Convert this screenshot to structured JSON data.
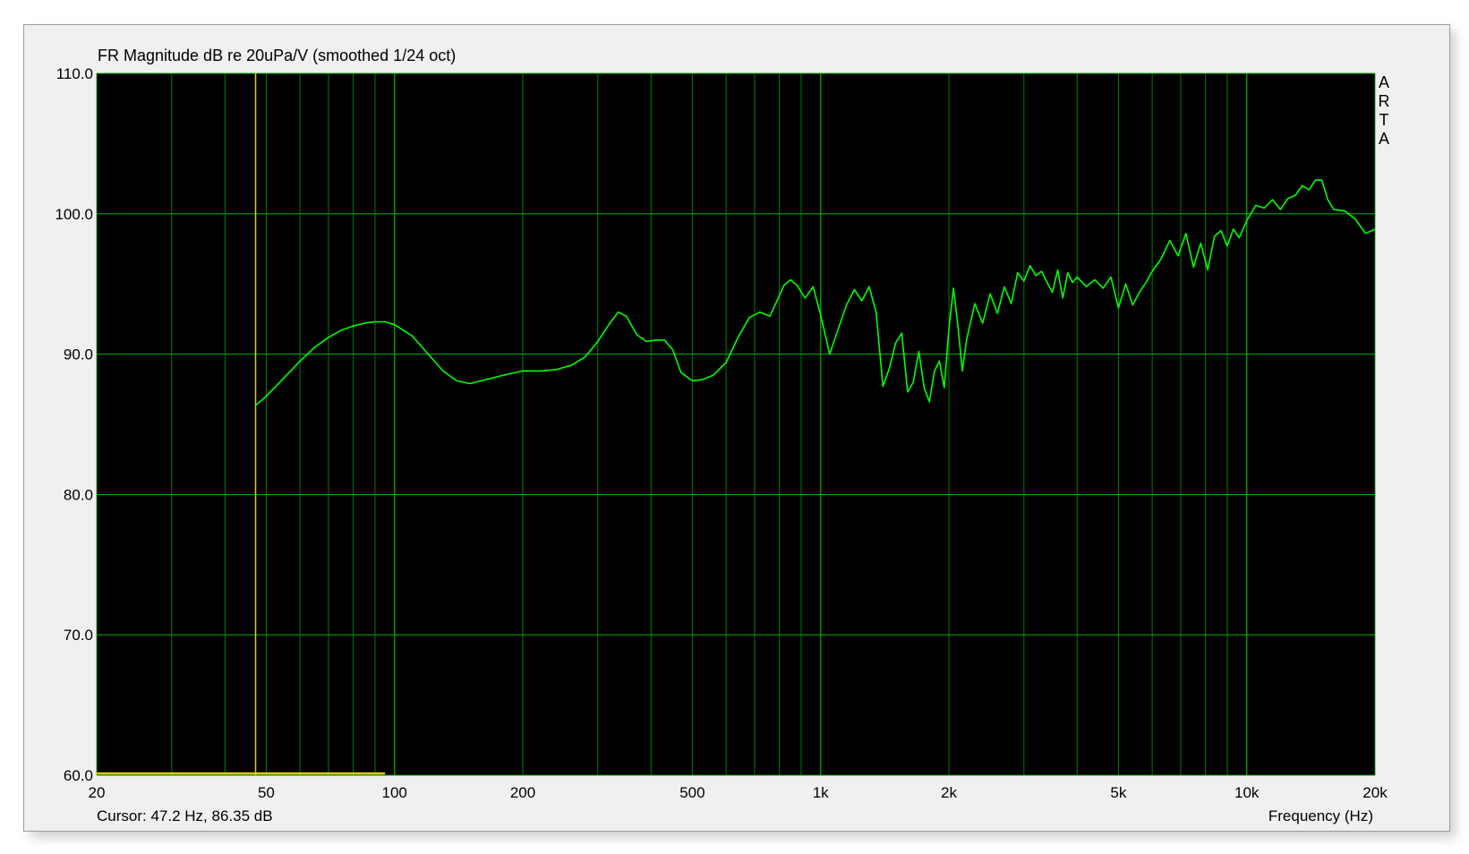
{
  "window": {
    "title": "FR Magnitude dB re 20uPa/V (smoothed 1/24 oct)",
    "cursor_readout": "Cursor: 47.2 Hz, 86.35 dB",
    "brand_letters": [
      "A",
      "R",
      "T",
      "A"
    ]
  },
  "colors": {
    "plot_bg": "#000000",
    "grid": "#00a000",
    "trace": "#00ff00",
    "cursor": "#e0d000",
    "frame_bg": "#f0f0f0"
  },
  "chart_data": {
    "type": "line",
    "title": "FR Magnitude dB re 20uPa/V (smoothed 1/24 oct)",
    "xlabel": "Frequency (Hz)",
    "ylabel": "",
    "xscale": "log",
    "xlim": [
      20,
      20000
    ],
    "ylim": [
      60,
      110
    ],
    "grid": true,
    "x_tick_values": [
      20,
      50,
      100,
      200,
      500,
      1000,
      2000,
      5000,
      10000,
      20000
    ],
    "x_tick_labels": [
      "20",
      "50",
      "100",
      "200",
      "500",
      "1k",
      "2k",
      "5k",
      "10k",
      "20k"
    ],
    "y_tick_values": [
      60,
      70,
      80,
      90,
      100,
      110
    ],
    "y_tick_labels": [
      "60.0",
      "70.0",
      "80.0",
      "90.0",
      "100.0",
      "110.0"
    ],
    "cursor": {
      "frequency_hz": 47.2,
      "level_db": 86.35
    },
    "series": [
      {
        "x": [
          47.2,
          50,
          55,
          60,
          65,
          70,
          75,
          80,
          85,
          90,
          95,
          100,
          110,
          120,
          130,
          140,
          150,
          160,
          180,
          200,
          220,
          240,
          260,
          280,
          300,
          320,
          335,
          350,
          370,
          390,
          410,
          430,
          450,
          470,
          500,
          530,
          560,
          600,
          640,
          680,
          720,
          760,
          790,
          820,
          850,
          880,
          920,
          960,
          1000,
          1050,
          1100,
          1150,
          1200,
          1250,
          1300,
          1350,
          1400,
          1450,
          1500,
          1550,
          1600,
          1650,
          1700,
          1750,
          1800,
          1850,
          1900,
          1950,
          2000,
          2050,
          2100,
          2150,
          2200,
          2300,
          2400,
          2500,
          2600,
          2700,
          2800,
          2900,
          3000,
          3100,
          3200,
          3300,
          3400,
          3500,
          3600,
          3700,
          3800,
          3900,
          4000,
          4200,
          4400,
          4600,
          4800,
          5000,
          5200,
          5400,
          5600,
          5800,
          6000,
          6300,
          6600,
          6900,
          7200,
          7500,
          7800,
          8100,
          8400,
          8700,
          9000,
          9300,
          9600,
          10000,
          10500,
          11000,
          11500,
          12000,
          12500,
          13000,
          13500,
          14000,
          14500,
          15000,
          15500,
          16000,
          17000,
          18000,
          19000,
          20000
        ],
        "y": [
          86.35,
          87.0,
          88.3,
          89.5,
          90.5,
          91.2,
          91.7,
          92.0,
          92.2,
          92.3,
          92.3,
          92.1,
          91.3,
          90.0,
          88.8,
          88.1,
          87.9,
          88.1,
          88.5,
          88.8,
          88.8,
          88.9,
          89.2,
          89.8,
          90.9,
          92.2,
          93.0,
          92.7,
          91.4,
          90.9,
          91.0,
          91.0,
          90.3,
          88.7,
          88.1,
          88.2,
          88.5,
          89.4,
          91.2,
          92.6,
          93.0,
          92.7,
          93.8,
          94.9,
          95.3,
          94.9,
          94.0,
          94.8,
          92.8,
          90.0,
          91.8,
          93.5,
          94.6,
          93.8,
          94.8,
          93.0,
          87.7,
          89.0,
          90.8,
          91.5,
          87.3,
          88.0,
          90.2,
          87.6,
          86.6,
          88.8,
          89.5,
          87.6,
          91.8,
          94.7,
          92.0,
          88.8,
          91.0,
          93.6,
          92.2,
          94.3,
          92.9,
          94.8,
          93.6,
          95.8,
          95.2,
          96.3,
          95.6,
          95.9,
          95.1,
          94.4,
          96.0,
          94.0,
          95.8,
          95.1,
          95.5,
          94.8,
          95.3,
          94.7,
          95.5,
          93.3,
          95.0,
          93.5,
          94.4,
          95.1,
          95.9,
          96.8,
          98.1,
          97.0,
          98.6,
          96.2,
          97.9,
          96.0,
          98.4,
          98.8,
          97.7,
          98.9,
          98.3,
          99.5,
          100.6,
          100.4,
          101.0,
          100.3,
          101.1,
          101.3,
          102.0,
          101.7,
          102.4,
          102.4,
          101.0,
          100.3,
          100.2,
          99.6,
          98.6,
          98.9
        ]
      }
    ]
  }
}
